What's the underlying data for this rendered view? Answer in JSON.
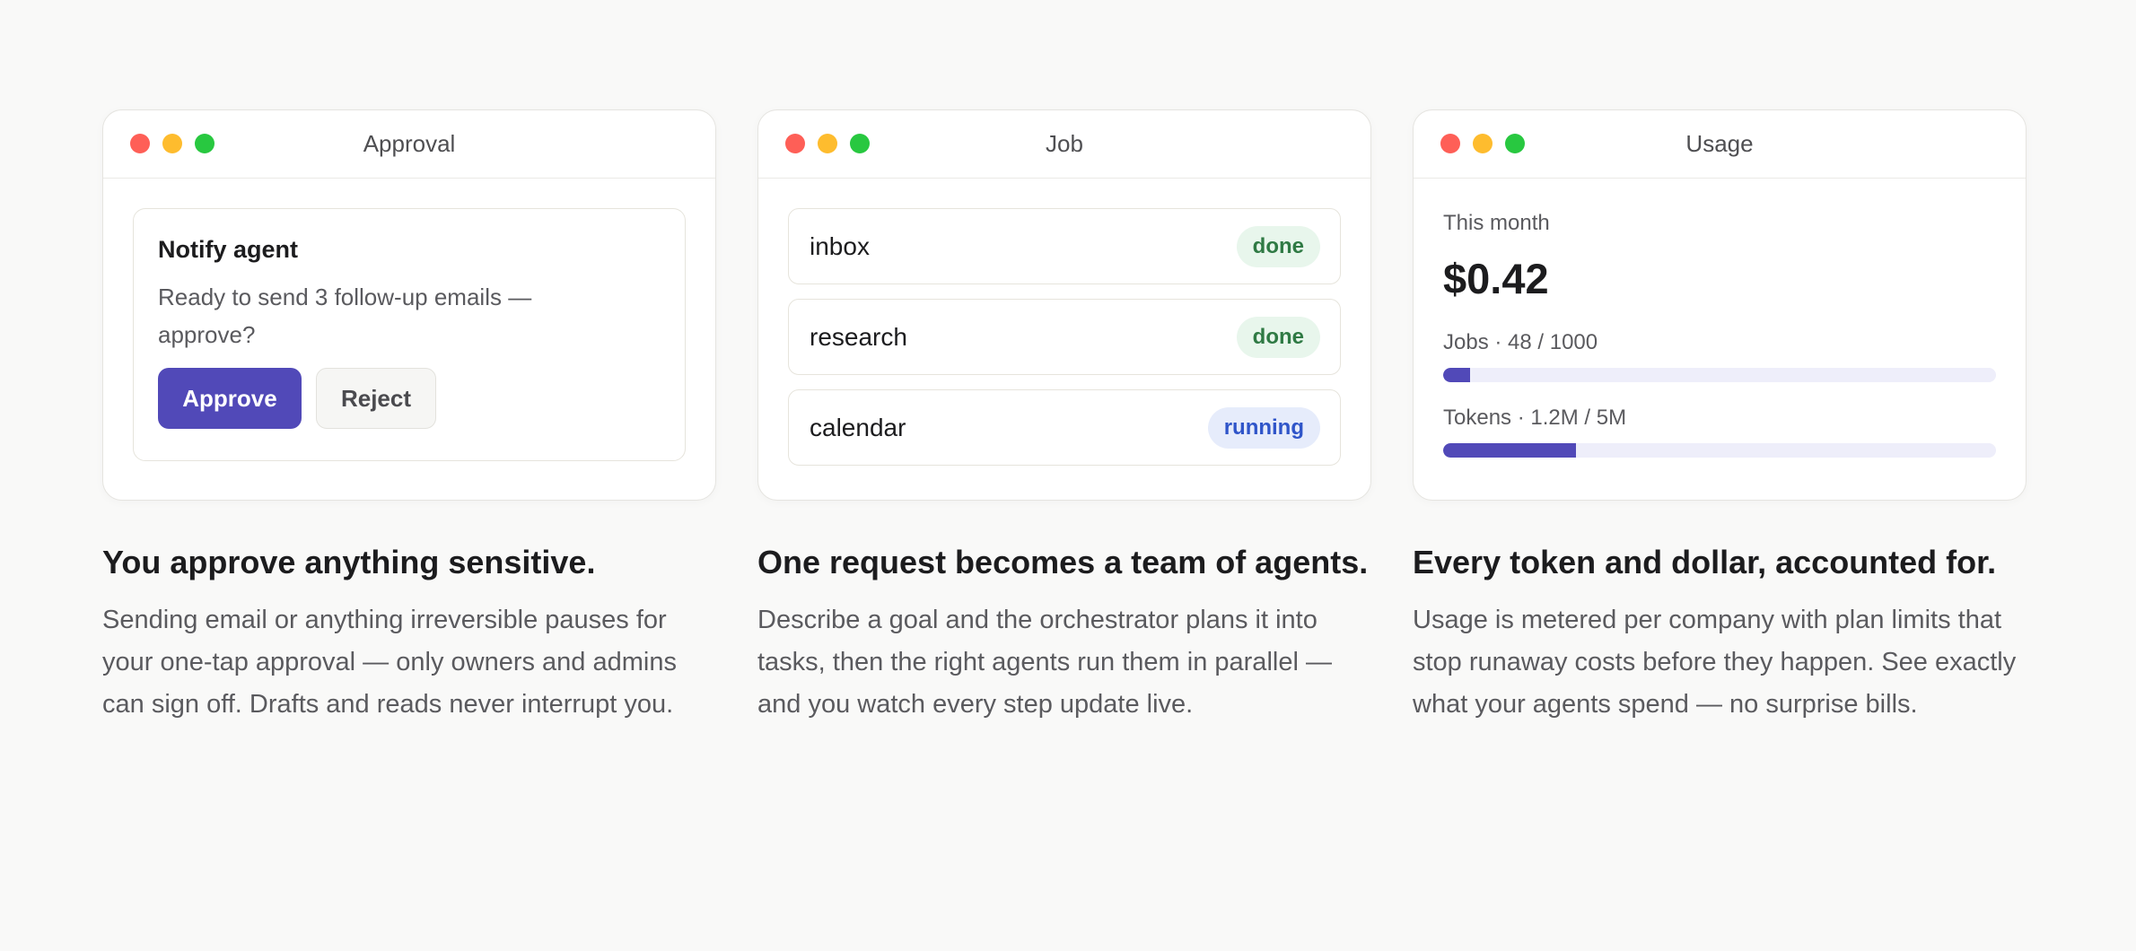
{
  "approval": {
    "window_title": "Approval",
    "card_title": "Notify agent",
    "card_text": "Ready to send 3 follow-up emails — approve?",
    "approve_label": "Approve",
    "reject_label": "Reject",
    "heading": "You approve anything sensitive.",
    "description": "Sending email or anything irreversible pauses for your one-tap approval — only owners and admins can sign off. Drafts and reads never interrupt you."
  },
  "job": {
    "window_title": "Job",
    "rows": [
      {
        "name": "inbox",
        "status": "done"
      },
      {
        "name": "research",
        "status": "done"
      },
      {
        "name": "calendar",
        "status": "running"
      }
    ],
    "heading": "One request becomes a team of agents.",
    "description": "Describe a goal and the orchestrator plans it into tasks, then the right agents run them in parallel — and you watch every step update live."
  },
  "usage": {
    "window_title": "Usage",
    "period_label": "This month",
    "amount": "$0.42",
    "jobs_label": "Jobs · 48 / 1000",
    "jobs_fraction": 0.048,
    "tokens_label": "Tokens · 1.2M / 5M",
    "tokens_fraction": 0.24,
    "heading": "Every token and dollar, accounted for.",
    "description": "Usage is metered per company with plan limits that stop runaway costs before they happen. See exactly what your agents spend — no surprise bills."
  },
  "colors": {
    "accent": "#5149b8",
    "done_bg": "#e8f6ec",
    "done_text": "#2f7a44",
    "running_bg": "#e6ecfb",
    "running_text": "#2f55c9"
  }
}
